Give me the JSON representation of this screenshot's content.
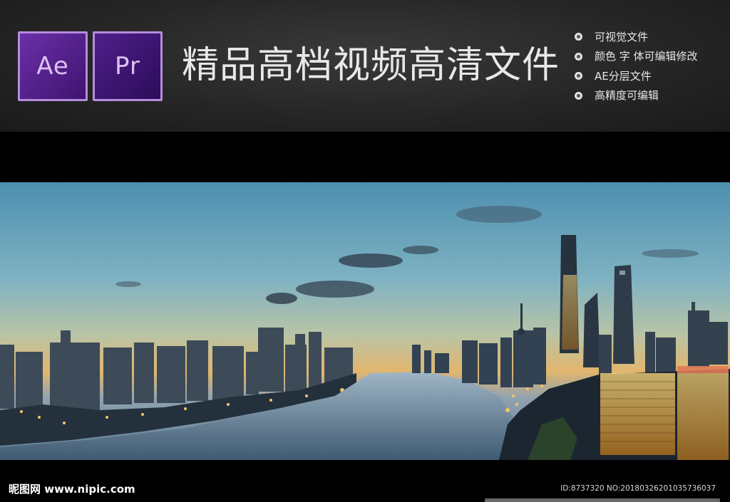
{
  "header": {
    "logos": [
      {
        "text": "Ae",
        "icon": "after-effects-icon"
      },
      {
        "text": "Pr",
        "icon": "premiere-pro-icon"
      }
    ],
    "headline": "精品高档视频高清文件",
    "features": [
      "可视觉文件",
      "颜色 字 体可编辑修改",
      "AE分层文件",
      "高精度可编辑"
    ]
  },
  "photo": {
    "description_icon": "city-skyline-photo"
  },
  "footer": {
    "brand": "昵图网 www.nipic.com",
    "id_text": "ID:8737320 NO:20180326201035736037"
  },
  "colors": {
    "logo_border": "#b48cdc",
    "logo_ae_bg": "#6b2fa8",
    "logo_pr_bg": "#4e1f8a",
    "banner_bg": "#262626"
  }
}
